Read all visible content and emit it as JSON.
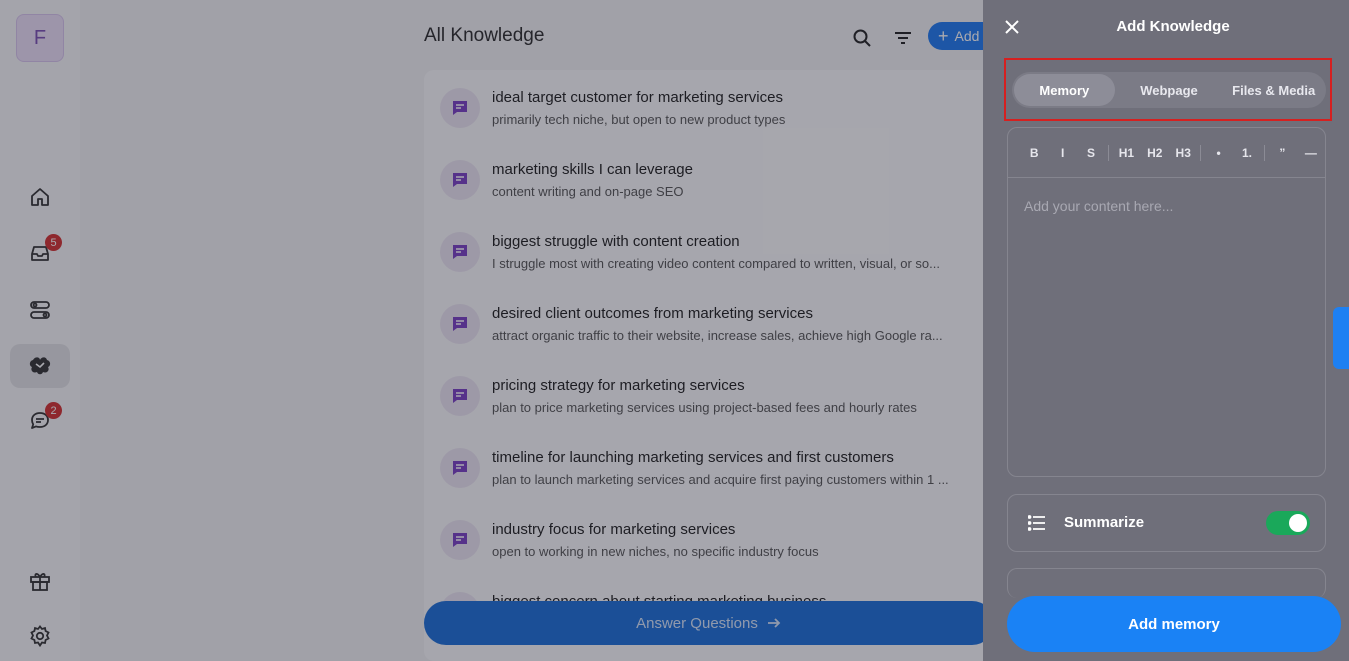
{
  "rail": {
    "avatar_letter": "F",
    "inbox_badge": "5",
    "chat_badge": "2"
  },
  "header": {
    "title": "All Knowledge",
    "add_label": "Add"
  },
  "items": [
    {
      "title": "ideal target customer for marketing services",
      "subtitle": "primarily tech niche, but open to new product types"
    },
    {
      "title": "marketing skills I can leverage",
      "subtitle": "content writing and on-page SEO"
    },
    {
      "title": "biggest struggle with content creation",
      "subtitle": "I struggle most with creating video content compared to written, visual, or so..."
    },
    {
      "title": "desired client outcomes from marketing services",
      "subtitle": "attract organic traffic to their website, increase sales, achieve high Google ra..."
    },
    {
      "title": "pricing strategy for marketing services",
      "subtitle": "plan to price marketing services using project-based fees and hourly rates"
    },
    {
      "title": "timeline for launching marketing services and first customers",
      "subtitle": "plan to launch marketing services and acquire first paying customers within 1 ..."
    },
    {
      "title": "industry focus for marketing services",
      "subtitle": "open to working in new niches, no specific industry focus"
    },
    {
      "title": "biggest concern about starting marketing business",
      "subtitle": ""
    }
  ],
  "answer_button": "Answer Questions",
  "panel": {
    "title": "Add Knowledge",
    "tabs": [
      {
        "label": "Memory"
      },
      {
        "label": "Webpage"
      },
      {
        "label": "Files & Media"
      }
    ],
    "toolbar": [
      "B",
      "I",
      "S",
      "H1",
      "H2",
      "H3",
      "•",
      "1.",
      "”",
      "—"
    ],
    "placeholder": "Add your content here...",
    "summarize_label": "Summarize",
    "summarize_on": true,
    "submit_label": "Add memory"
  },
  "colors": {
    "accent": "#1a82f5",
    "toggle_on": "#1aa85a",
    "highlight_box": "#d62020"
  }
}
